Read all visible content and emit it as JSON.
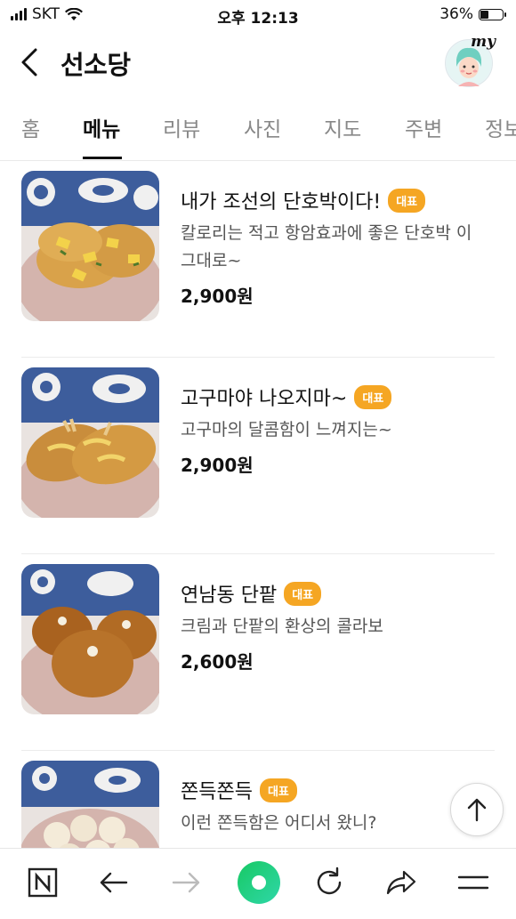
{
  "status": {
    "carrier": "SKT",
    "time": "오후 12:13",
    "battery": "36%"
  },
  "header": {
    "title": "선소당",
    "avatar_label": "my"
  },
  "tabs": [
    {
      "label": "홈"
    },
    {
      "label": "메뉴"
    },
    {
      "label": "리뷰"
    },
    {
      "label": "사진"
    },
    {
      "label": "지도"
    },
    {
      "label": "주변"
    },
    {
      "label": "정보"
    }
  ],
  "menu": [
    {
      "name": "내가 조선의 단호박이다!",
      "badge": "대표",
      "desc": "칼로리는 적고 항암효과에 좋은 단호박 이 그대로~",
      "price": "2,900원"
    },
    {
      "name": "고구마야 나오지마~",
      "badge": "대표",
      "desc": "고구마의 달콤함이 느껴지는~",
      "price": "2,900원"
    },
    {
      "name": "연남동 단팥",
      "badge": "대표",
      "desc": "크림과 단팥의 환상의 콜라보",
      "price": "2,600원"
    },
    {
      "name": "쫀득쫀득",
      "badge": "대표",
      "desc": "이런 쫀득함은 어디서 왔니?",
      "price": ""
    }
  ],
  "icons": {
    "back": "chevron-left-icon",
    "scroll_top": "arrow-up-icon",
    "bottom_bar": [
      "naver-n-icon",
      "arrow-left-icon",
      "arrow-right-icon",
      "home-circle-icon",
      "refresh-icon",
      "share-icon",
      "menu-icon"
    ]
  },
  "colors": {
    "badge": "#f5a623",
    "green_button": "#2fd36b",
    "active_tab": "#111111"
  }
}
